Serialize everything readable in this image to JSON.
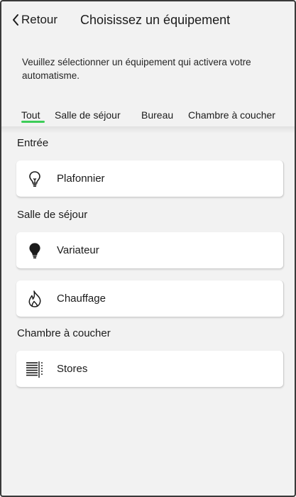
{
  "header": {
    "back_label": "Retour",
    "title": "Choisissez un équipement"
  },
  "description": "Veuillez sélectionner un équipement qui activera votre automatisme.",
  "tabs": [
    {
      "label": "Tout",
      "active": true
    },
    {
      "label": "Salle de séjour",
      "active": false
    },
    {
      "label": "Bureau",
      "active": false
    },
    {
      "label": "Chambre à coucher",
      "active": false
    }
  ],
  "accent_color": "#3dcd58",
  "sections": [
    {
      "title": "Entrée",
      "devices": [
        {
          "label": "Plafonnier",
          "icon": "lightbulb-outline-icon"
        }
      ]
    },
    {
      "title": "Salle de séjour",
      "devices": [
        {
          "label": "Variateur",
          "icon": "lightbulb-filled-icon"
        },
        {
          "label": "Chauffage",
          "icon": "flame-icon"
        }
      ]
    },
    {
      "title": "Chambre à coucher",
      "devices": [
        {
          "label": "Stores",
          "icon": "blinds-icon"
        }
      ]
    }
  ]
}
